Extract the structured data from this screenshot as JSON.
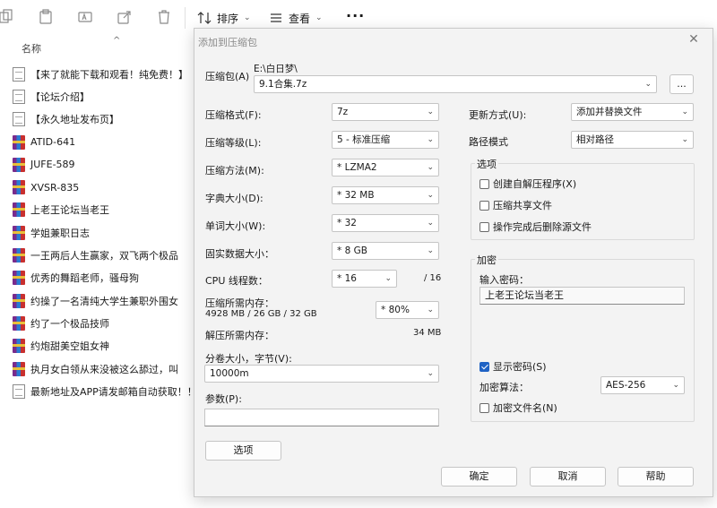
{
  "explorer": {
    "toolbar": {
      "sort_label": "排序",
      "view_label": "查看",
      "more_label": "···"
    },
    "column_header": "名称",
    "files": [
      {
        "name": "【来了就能下载和观看！纯免费！】",
        "icon": "doc"
      },
      {
        "name": "【论坛介绍】",
        "icon": "doc"
      },
      {
        "name": "【永久地址发布页】",
        "icon": "doc"
      },
      {
        "name": "ATID-641",
        "icon": "rar"
      },
      {
        "name": "JUFE-589",
        "icon": "rar"
      },
      {
        "name": "XVSR-835",
        "icon": "rar"
      },
      {
        "name": "上老王论坛当老王",
        "icon": "rar"
      },
      {
        "name": "学姐兼职日志",
        "icon": "rar"
      },
      {
        "name": "一王两后人生赢家，双飞两个极品",
        "icon": "rar"
      },
      {
        "name": "优秀的舞蹈老师，骚母狗",
        "icon": "rar"
      },
      {
        "name": "约操了一名清纯大学生兼职外围女",
        "icon": "rar"
      },
      {
        "name": "约了一个极品技师",
        "icon": "rar"
      },
      {
        "name": "约炮甜美空姐女神",
        "icon": "rar"
      },
      {
        "name": "执月女白领从来没被这么舔过，叫",
        "icon": "rar"
      },
      {
        "name": "最新地址及APP请发邮箱自动获取！！",
        "icon": "doc"
      }
    ]
  },
  "dialog": {
    "title": "添加到压缩包",
    "archive_label": "压缩包(A)",
    "archive_path": "E:\\白日梦\\",
    "archive_name": "9.1合集.7z",
    "browse_label": "...",
    "left": {
      "format_label": "压缩格式(F):",
      "format_value": "7z",
      "level_label": "压缩等级(L):",
      "level_value": "5 - 标准压缩",
      "method_label": "压缩方法(M):",
      "method_value": "* LZMA2",
      "dict_label": "字典大小(D):",
      "dict_value": "* 32 MB",
      "word_label": "单词大小(W):",
      "word_value": "* 32",
      "solid_label": "固实数据大小：",
      "solid_value": "* 8 GB",
      "cpu_label": "CPU 线程数：",
      "cpu_value": "* 16",
      "cpu_total": "/ 16",
      "mem_comp_label": "压缩所需内存：",
      "mem_comp_detail": "4928 MB / 26 GB / 32 GB",
      "mem_comp_value": "* 80%",
      "mem_decomp_label": "解压所需内存：",
      "mem_decomp_value": "34 MB",
      "split_label": "分卷大小，字节(V):",
      "split_value": "10000m",
      "params_label": "参数(P):",
      "params_value": "",
      "options_button": "选项"
    },
    "right": {
      "update_label": "更新方式(U):",
      "update_value": "添加并替换文件",
      "path_label": "路径模式",
      "path_value": "相对路径",
      "options_group": "选项",
      "opt_sfx": "创建自解压程序(X)",
      "opt_shared": "压缩共享文件",
      "opt_delete": "操作完成后删除源文件",
      "encrypt_group": "加密",
      "password_label": "输入密码：",
      "password_value": "上老王论坛当老王",
      "show_password": "显示密码(S)",
      "algo_label": "加密算法：",
      "algo_value": "AES-256",
      "encrypt_names": "加密文件名(N)"
    },
    "buttons": {
      "ok": "确定",
      "cancel": "取消",
      "help": "帮助"
    }
  }
}
